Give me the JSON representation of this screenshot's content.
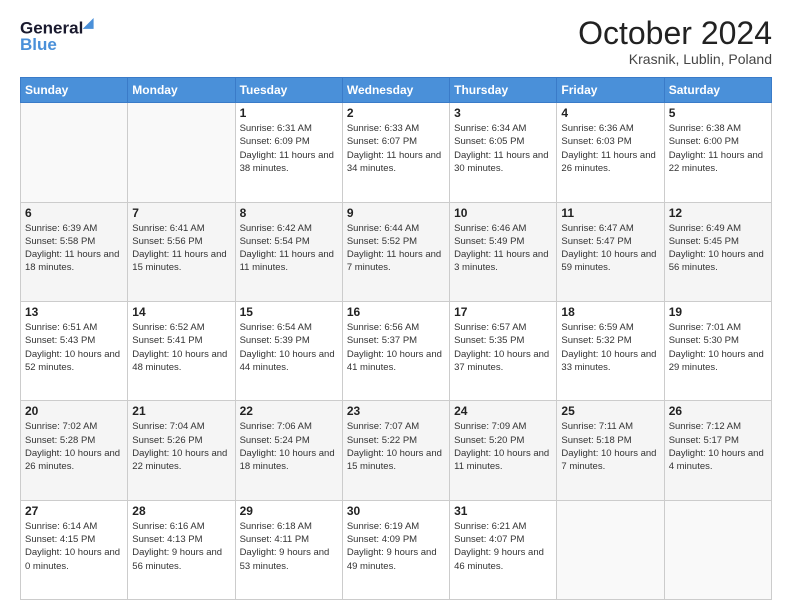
{
  "header": {
    "logo_line1": "General",
    "logo_line2": "Blue",
    "month": "October 2024",
    "location": "Krasnik, Lublin, Poland"
  },
  "weekdays": [
    "Sunday",
    "Monday",
    "Tuesday",
    "Wednesday",
    "Thursday",
    "Friday",
    "Saturday"
  ],
  "weeks": [
    [
      {
        "day": "",
        "info": ""
      },
      {
        "day": "",
        "info": ""
      },
      {
        "day": "1",
        "info": "Sunrise: 6:31 AM\nSunset: 6:09 PM\nDaylight: 11 hours and 38 minutes."
      },
      {
        "day": "2",
        "info": "Sunrise: 6:33 AM\nSunset: 6:07 PM\nDaylight: 11 hours and 34 minutes."
      },
      {
        "day": "3",
        "info": "Sunrise: 6:34 AM\nSunset: 6:05 PM\nDaylight: 11 hours and 30 minutes."
      },
      {
        "day": "4",
        "info": "Sunrise: 6:36 AM\nSunset: 6:03 PM\nDaylight: 11 hours and 26 minutes."
      },
      {
        "day": "5",
        "info": "Sunrise: 6:38 AM\nSunset: 6:00 PM\nDaylight: 11 hours and 22 minutes."
      }
    ],
    [
      {
        "day": "6",
        "info": "Sunrise: 6:39 AM\nSunset: 5:58 PM\nDaylight: 11 hours and 18 minutes."
      },
      {
        "day": "7",
        "info": "Sunrise: 6:41 AM\nSunset: 5:56 PM\nDaylight: 11 hours and 15 minutes."
      },
      {
        "day": "8",
        "info": "Sunrise: 6:42 AM\nSunset: 5:54 PM\nDaylight: 11 hours and 11 minutes."
      },
      {
        "day": "9",
        "info": "Sunrise: 6:44 AM\nSunset: 5:52 PM\nDaylight: 11 hours and 7 minutes."
      },
      {
        "day": "10",
        "info": "Sunrise: 6:46 AM\nSunset: 5:49 PM\nDaylight: 11 hours and 3 minutes."
      },
      {
        "day": "11",
        "info": "Sunrise: 6:47 AM\nSunset: 5:47 PM\nDaylight: 10 hours and 59 minutes."
      },
      {
        "day": "12",
        "info": "Sunrise: 6:49 AM\nSunset: 5:45 PM\nDaylight: 10 hours and 56 minutes."
      }
    ],
    [
      {
        "day": "13",
        "info": "Sunrise: 6:51 AM\nSunset: 5:43 PM\nDaylight: 10 hours and 52 minutes."
      },
      {
        "day": "14",
        "info": "Sunrise: 6:52 AM\nSunset: 5:41 PM\nDaylight: 10 hours and 48 minutes."
      },
      {
        "day": "15",
        "info": "Sunrise: 6:54 AM\nSunset: 5:39 PM\nDaylight: 10 hours and 44 minutes."
      },
      {
        "day": "16",
        "info": "Sunrise: 6:56 AM\nSunset: 5:37 PM\nDaylight: 10 hours and 41 minutes."
      },
      {
        "day": "17",
        "info": "Sunrise: 6:57 AM\nSunset: 5:35 PM\nDaylight: 10 hours and 37 minutes."
      },
      {
        "day": "18",
        "info": "Sunrise: 6:59 AM\nSunset: 5:32 PM\nDaylight: 10 hours and 33 minutes."
      },
      {
        "day": "19",
        "info": "Sunrise: 7:01 AM\nSunset: 5:30 PM\nDaylight: 10 hours and 29 minutes."
      }
    ],
    [
      {
        "day": "20",
        "info": "Sunrise: 7:02 AM\nSunset: 5:28 PM\nDaylight: 10 hours and 26 minutes."
      },
      {
        "day": "21",
        "info": "Sunrise: 7:04 AM\nSunset: 5:26 PM\nDaylight: 10 hours and 22 minutes."
      },
      {
        "day": "22",
        "info": "Sunrise: 7:06 AM\nSunset: 5:24 PM\nDaylight: 10 hours and 18 minutes."
      },
      {
        "day": "23",
        "info": "Sunrise: 7:07 AM\nSunset: 5:22 PM\nDaylight: 10 hours and 15 minutes."
      },
      {
        "day": "24",
        "info": "Sunrise: 7:09 AM\nSunset: 5:20 PM\nDaylight: 10 hours and 11 minutes."
      },
      {
        "day": "25",
        "info": "Sunrise: 7:11 AM\nSunset: 5:18 PM\nDaylight: 10 hours and 7 minutes."
      },
      {
        "day": "26",
        "info": "Sunrise: 7:12 AM\nSunset: 5:17 PM\nDaylight: 10 hours and 4 minutes."
      }
    ],
    [
      {
        "day": "27",
        "info": "Sunrise: 6:14 AM\nSunset: 4:15 PM\nDaylight: 10 hours and 0 minutes."
      },
      {
        "day": "28",
        "info": "Sunrise: 6:16 AM\nSunset: 4:13 PM\nDaylight: 9 hours and 56 minutes."
      },
      {
        "day": "29",
        "info": "Sunrise: 6:18 AM\nSunset: 4:11 PM\nDaylight: 9 hours and 53 minutes."
      },
      {
        "day": "30",
        "info": "Sunrise: 6:19 AM\nSunset: 4:09 PM\nDaylight: 9 hours and 49 minutes."
      },
      {
        "day": "31",
        "info": "Sunrise: 6:21 AM\nSunset: 4:07 PM\nDaylight: 9 hours and 46 minutes."
      },
      {
        "day": "",
        "info": ""
      },
      {
        "day": "",
        "info": ""
      }
    ]
  ],
  "row_shading": [
    "white",
    "shade",
    "white",
    "shade",
    "white"
  ]
}
